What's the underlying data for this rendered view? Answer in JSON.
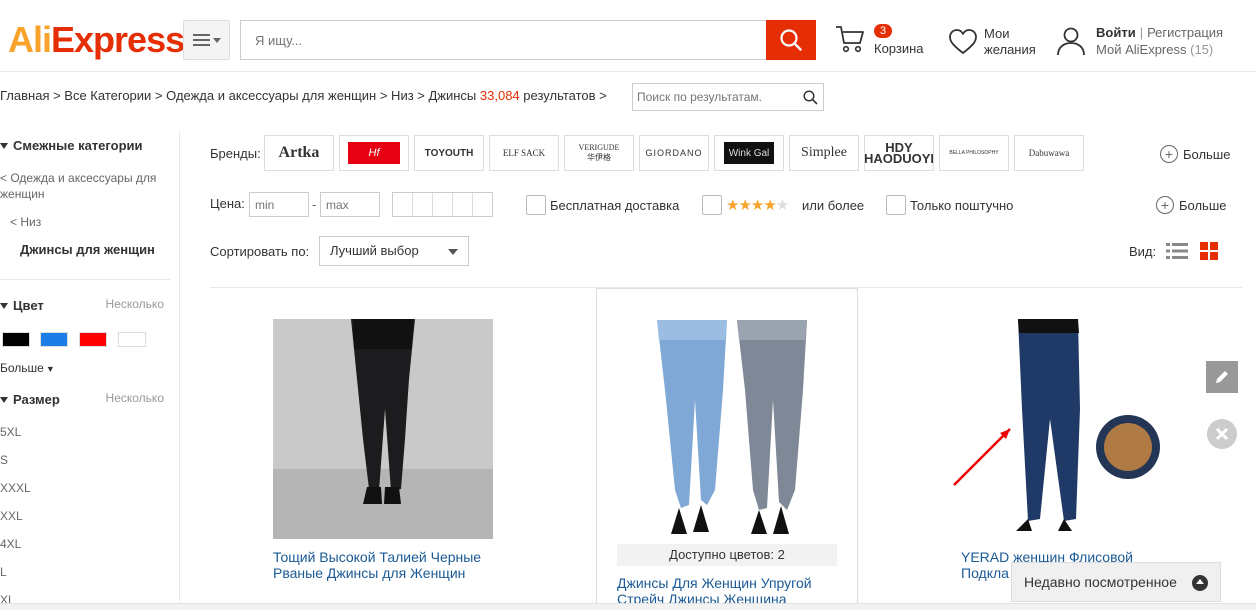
{
  "header": {
    "logo_ali": "Ali",
    "logo_express": "Express",
    "logo_tm": "™",
    "search_placeholder": "Я ищу...",
    "cart_count": "3",
    "cart_label": "Корзина",
    "wish_label_1": "Мои",
    "wish_label_2": "желания",
    "login": "Войти",
    "register": "Регистрация",
    "my_ali": "Мой AliExpress",
    "my_ali_count": "(15)"
  },
  "breadcrumb": {
    "path": "Главная > Все Категории > Одежда и аксессуары для женщин > Низ > Джинсы",
    "count": "33,084",
    "results": "результатов >",
    "search_placeholder": "Поиск по результатам."
  },
  "sidebar": {
    "related_title": "Смежные категории",
    "parent": "< Одежда и аксессуары для женщин",
    "sub": "< Низ",
    "current": "Джинсы для женщин",
    "color_title": "Цвет",
    "color_multi": "Несколько",
    "colors": [
      "#000000",
      "#1a7ee6",
      "#ff0000",
      "#ffffff"
    ],
    "more": "Больше",
    "size_title": "Размер",
    "size_multi": "Несколько",
    "sizes": [
      "5XL",
      "S",
      "XXXL",
      "XXL",
      "4XL",
      "L",
      "XL"
    ]
  },
  "filters": {
    "brands_label": "Бренды:",
    "brands": [
      "Artka",
      "Hf",
      "TOYOUTH",
      "ELF SACK",
      "VERIGUDE 华伊格",
      "GIORDANO",
      "Wink Gal",
      "Simplee",
      "HDY HAODUOYI",
      "BELLA PHILOSOPHY",
      "Dabuwawa"
    ],
    "more": "Больше",
    "price_label": "Цена:",
    "min_placeholder": "min",
    "max_placeholder": "max",
    "free_shipping": "Бесплатная доставка",
    "rating_or_more": "или более",
    "single_only": "Только поштучно",
    "more2": "Больше",
    "sort_label": "Сортировать по:",
    "sort_value": "Лучший выбор",
    "view_label": "Вид:"
  },
  "products": [
    {
      "title": "Тощий Высокой Талией Черные Рваные Джинсы для Женщин"
    },
    {
      "title": "Джинсы Для Женщин Упругой Стрейч Джинсы Женщина",
      "colors": "Доступно цветов: 2"
    },
    {
      "title": "YERAD женщин Флисовой Подкла"
    }
  ],
  "recently_viewed": "Недавно посмотренное"
}
